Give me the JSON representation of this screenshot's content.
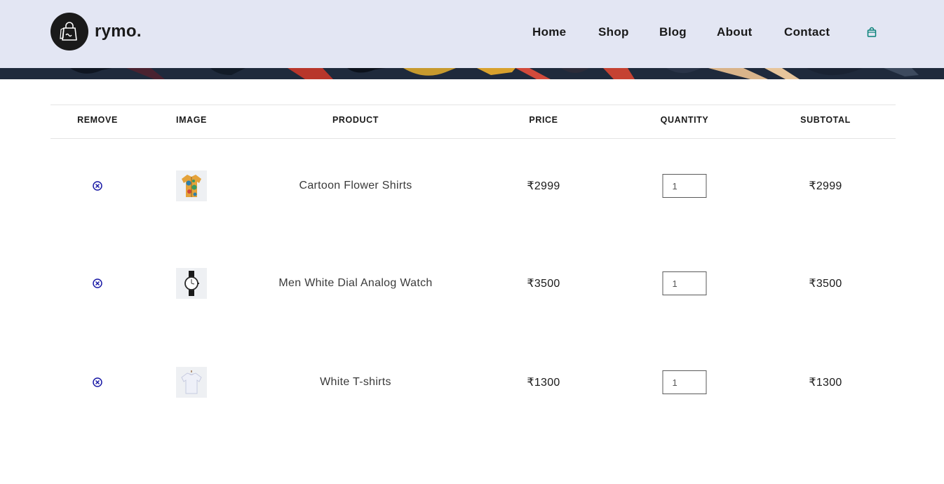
{
  "brand": {
    "name": "rymo."
  },
  "nav": {
    "items": [
      {
        "label": "Home"
      },
      {
        "label": "Shop"
      },
      {
        "label": "Blog"
      },
      {
        "label": "About"
      },
      {
        "label": "Contact"
      }
    ],
    "cart_icon": "shopping-bag-icon"
  },
  "table": {
    "headers": {
      "remove": "REMOVE",
      "image": "IMAGE",
      "product": "PRODUCT",
      "price": "PRICE",
      "quantity": "QUANTITY",
      "subtotal": "SUBTOTAL"
    },
    "rows": [
      {
        "product": "Cartoon Flower Shirts",
        "price": "₹2999",
        "quantity": "1",
        "subtotal": "₹2999",
        "image_icon": "floral-shirt-image"
      },
      {
        "product": "Men White Dial Analog Watch",
        "price": "₹3500",
        "quantity": "1",
        "subtotal": "₹3500",
        "image_icon": "watch-image"
      },
      {
        "product": "White T-shirts",
        "price": "₹1300",
        "quantity": "1",
        "subtotal": "₹1300",
        "image_icon": "tshirt-image"
      }
    ]
  },
  "colors": {
    "header_bg": "#e3e6f3",
    "accent": "#088178",
    "remove_icon": "#1a1aa6"
  }
}
